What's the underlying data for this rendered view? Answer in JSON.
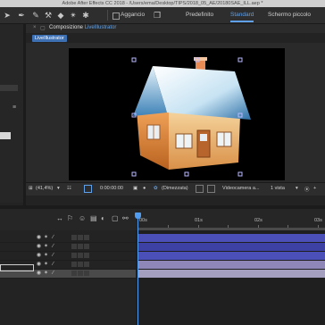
{
  "window": {
    "title": "Adobe After Effects CC 2018 - /Users/ema/Desktop/TIPS/2018_05_AE/20180SAE_ILL.aep *"
  },
  "toolbar": {
    "snap_label": "Aggancio",
    "workspaces": [
      "Predefinito",
      "Standard",
      "Schermo piccolo"
    ],
    "active_workspace": "Standard"
  },
  "composition": {
    "tab_prefix": "Composizione",
    "tab_name": "LiveIllustrator",
    "breadcrumb": "LiveIllustrator"
  },
  "viewer": {
    "zoom": "(41,4%)",
    "timecode": "0:00:00:00",
    "resolution": "(Dimezzata)",
    "camera": "Videocamera a...",
    "views": "1 vista"
  },
  "timeline": {
    "ruler_labels": [
      "00s",
      "01s",
      "02s",
      "03s"
    ]
  },
  "colors": {
    "accent": "#5fa0e8",
    "layer_bar_blue": "#4b4fb8",
    "layer_bar_violet": "#8f87b8",
    "layer_bar_light": "#a49fbf"
  }
}
